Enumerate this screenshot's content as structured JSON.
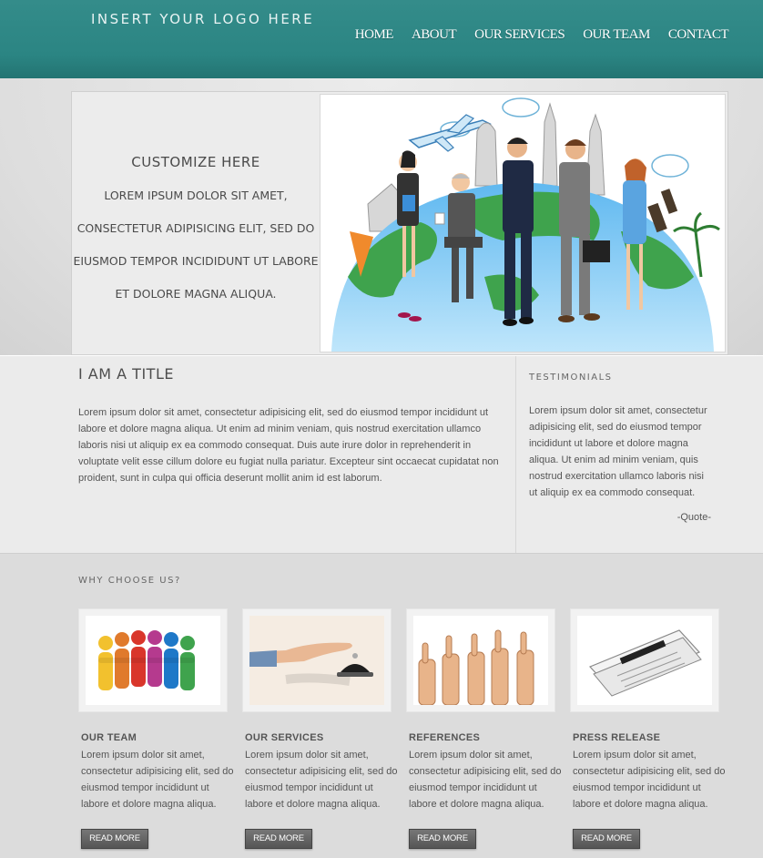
{
  "header": {
    "logo": "INSERT YOUR LOGO HERE",
    "nav": [
      "HOME",
      "ABOUT",
      "OUR SERVICES",
      "OUR TEAM",
      "CONTACT"
    ]
  },
  "hero": {
    "title": "CUSTOMIZE HERE",
    "body": "LOREM IPSUM DOLOR SIT AMET, CONSECTETUR ADIPISICING ELIT, SED DO EIUSMOD TEMPOR INCIDIDUNT UT LABORE ET DOLORE MAGNA ALIQUA."
  },
  "about": {
    "title": "I AM A TITLE",
    "body": "Lorem ipsum dolor sit amet, consectetur adipisicing elit, sed do eiusmod tempor incididunt ut labore et dolore magna aliqua. Ut enim ad minim veniam, quis nostrud exercitation ullamco laboris nisi ut aliquip ex ea commodo consequat. Duis aute irure dolor in reprehenderit in voluptate velit esse cillum dolore eu fugiat nulla pariatur. Excepteur sint occaecat cupidatat non proident, sunt in culpa qui officia deserunt mollit anim id est laborum."
  },
  "testimonials": {
    "title": "TESTIMONIALS",
    "body": "Lorem ipsum dolor sit amet, consectetur adipisicing elit, sed do eiusmod tempor incididunt ut labore et dolore magna aliqua. Ut enim ad minim veniam, quis nostrud exercitation ullamco laboris nisi ut aliquip ex ea commodo consequat.",
    "author": "-Quote-"
  },
  "why": {
    "title": "WHY CHOOSE US?",
    "cards": [
      {
        "title": "OUR TEAM",
        "body": "Lorem ipsum dolor sit amet, consectetur adipisicing elit, sed do eiusmod tempor incididunt ut labore et dolore magna aliqua.",
        "button": "READ MORE"
      },
      {
        "title": "OUR SERVICES",
        "body": "Lorem ipsum dolor sit amet, consectetur adipisicing elit, sed do eiusmod tempor incididunt ut labore et dolore magna aliqua.",
        "button": "READ MORE"
      },
      {
        "title": "REFERENCES",
        "body": "Lorem ipsum dolor sit amet, consectetur adipisicing elit, sed do eiusmod tempor incididunt ut labore et dolore magna aliqua.",
        "button": "READ MORE"
      },
      {
        "title": "PRESS RELEASE",
        "body": "Lorem ipsum dolor sit amet, consectetur adipisicing elit, sed do eiusmod tempor incididunt ut labore et dolore magna aliqua.",
        "button": "READ MORE"
      }
    ]
  },
  "colors": {
    "header": "#2e8886",
    "button": "#666666"
  }
}
